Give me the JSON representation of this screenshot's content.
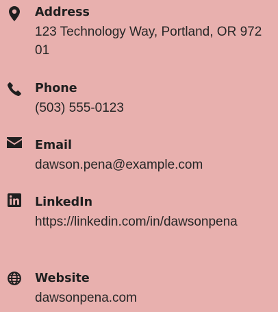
{
  "contact": {
    "address": {
      "label": "Address",
      "value": "123 Technology Way, Portland, OR 97201",
      "icon": "map-marker-icon"
    },
    "phone": {
      "label": "Phone",
      "value": "(503) 555-0123",
      "icon": "phone-icon"
    },
    "email": {
      "label": "Email",
      "value": "dawson.pena@example.com",
      "icon": "envelope-icon"
    },
    "linkedin": {
      "label": "LinkedIn",
      "value": "https://linkedin.com/in/dawsonpena",
      "icon": "linkedin-icon"
    },
    "website": {
      "label": "Website",
      "value": "dawsonpena.com",
      "icon": "globe-icon"
    }
  },
  "colors": {
    "background": "#e8b0ae",
    "text": "#1f1f1f"
  }
}
